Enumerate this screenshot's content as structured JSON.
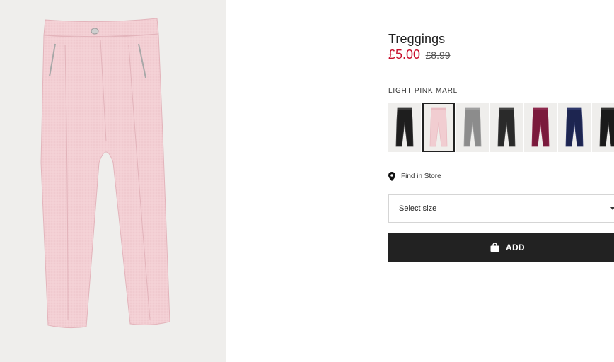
{
  "product": {
    "title": "Treggings",
    "price_current": "£5.00",
    "price_old": "£8.99",
    "color_name": "LIGHT PINK MARL",
    "image_icon": "pink-treggings-photo"
  },
  "swatches": [
    {
      "color": "#1e1e1e",
      "accent": "#3a3a3a",
      "selected": false
    },
    {
      "color": "#f1cdd1",
      "accent": "#e9bcc2",
      "selected": true
    },
    {
      "color": "#8c8c8c",
      "accent": "#a0a0a0",
      "selected": false
    },
    {
      "color": "#2a2a2a",
      "accent": "#444444",
      "selected": false
    },
    {
      "color": "#7a1a3c",
      "accent": "#8e2a4e",
      "selected": false
    },
    {
      "color": "#1d2550",
      "accent": "#2f386a",
      "selected": false
    },
    {
      "color": "#1a1a1a",
      "accent": "#333333",
      "selected": false
    }
  ],
  "store": {
    "find_label": "Find in Store",
    "icon": "location-pin-icon"
  },
  "size": {
    "placeholder": "Select size",
    "icon": "chevron-down-icon"
  },
  "cart": {
    "add_label": "ADD",
    "icon": "shopping-bag-icon"
  },
  "colors": {
    "price_sale": "#c8102e",
    "button_bg": "#222222",
    "image_bg": "#efeeec"
  }
}
